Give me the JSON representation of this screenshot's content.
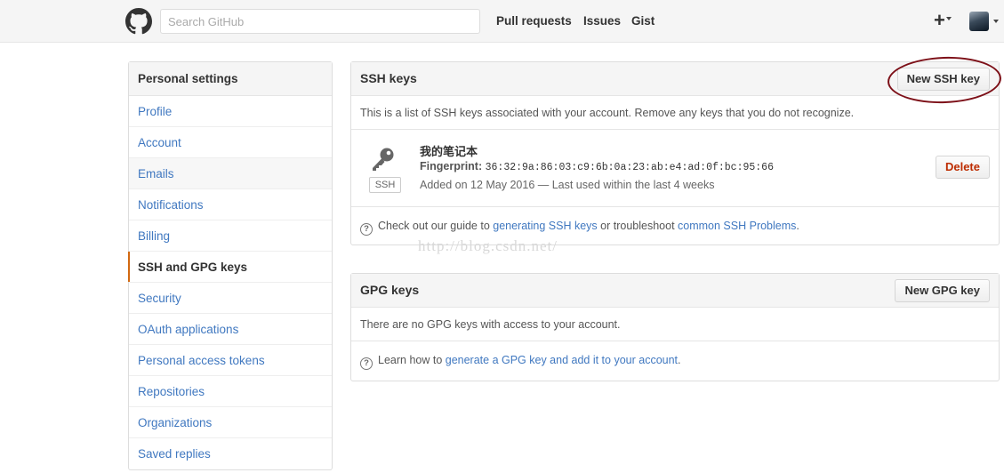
{
  "header": {
    "search_placeholder": "Search GitHub",
    "nav": [
      "Pull requests",
      "Issues",
      "Gist"
    ],
    "plus_label": "+",
    "icons": {
      "logo": "github-logo",
      "plus": "plus-icon",
      "avatar": "user-avatar"
    }
  },
  "sidebar": {
    "heading": "Personal settings",
    "items": [
      {
        "label": "Profile"
      },
      {
        "label": "Account"
      },
      {
        "label": "Emails"
      },
      {
        "label": "Notifications"
      },
      {
        "label": "Billing"
      },
      {
        "label": "SSH and GPG keys",
        "selected": true
      },
      {
        "label": "Security"
      },
      {
        "label": "OAuth applications"
      },
      {
        "label": "Personal access tokens"
      },
      {
        "label": "Repositories"
      },
      {
        "label": "Organizations"
      },
      {
        "label": "Saved replies"
      }
    ]
  },
  "ssh": {
    "title": "SSH keys",
    "new_button": "New SSH key",
    "description": "This is a list of SSH keys associated with your account. Remove any keys that you do not recognize.",
    "key": {
      "name": "我的笔记本",
      "fingerprint_label": "Fingerprint:",
      "fingerprint": "36:32:9a:86:03:c9:6b:0a:23:ab:e4:ad:0f:bc:95:66",
      "added": "Added on 12 May 2016 — Last used within the last 4 weeks",
      "badge": "SSH",
      "delete_button": "Delete"
    },
    "help": {
      "prefix": "Check out our guide to ",
      "link1": "generating SSH keys",
      "middle": " or troubleshoot ",
      "link2": "common SSH Problems",
      "suffix": "."
    }
  },
  "watermark": "http://blog.csdn.net/",
  "gpg": {
    "title": "GPG keys",
    "new_button": "New GPG key",
    "description": "There are no GPG keys with access to your account.",
    "help": {
      "prefix": "Learn how to ",
      "link": "generate a GPG key and add it to your account",
      "suffix": "."
    }
  },
  "colors": {
    "link": "#4078c0",
    "selected_accent": "#d26911",
    "delete": "#bd2c00",
    "annotation_circle": "#7d1018"
  }
}
